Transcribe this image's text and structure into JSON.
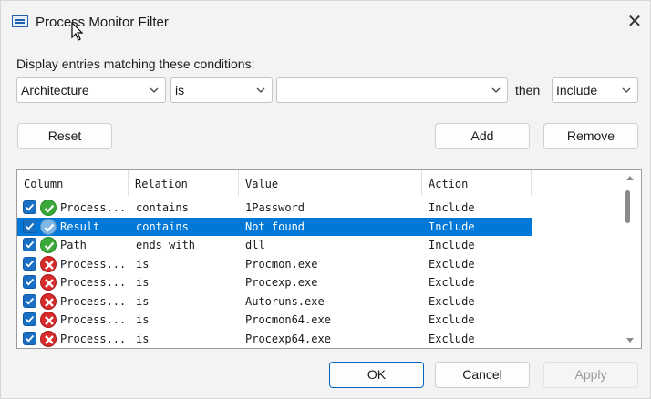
{
  "window": {
    "title": "Process Monitor Filter",
    "close_glyph": "✕"
  },
  "conditions": {
    "label": "Display entries matching these conditions:",
    "column_value": "Architecture",
    "relation_value": "is",
    "value_value": "",
    "then_label": "then",
    "action_value": "Include"
  },
  "buttons": {
    "reset": "Reset",
    "add": "Add",
    "remove": "Remove",
    "ok": "OK",
    "cancel": "Cancel",
    "apply": "Apply"
  },
  "table": {
    "headers": [
      "Column",
      "Relation",
      "Value",
      "Action"
    ],
    "rows": [
      {
        "column": "Process...",
        "relation": "contains",
        "value": "1Password",
        "action": "Include",
        "checked": true,
        "state": "include",
        "selected": false
      },
      {
        "column": "Result",
        "relation": "contains",
        "value": "Not found",
        "action": "Include",
        "checked": true,
        "state": "include",
        "selected": true
      },
      {
        "column": "Path",
        "relation": "ends with",
        "value": "dll",
        "action": "Include",
        "checked": true,
        "state": "include",
        "selected": false
      },
      {
        "column": "Process...",
        "relation": "is",
        "value": "Procmon.exe",
        "action": "Exclude",
        "checked": true,
        "state": "exclude",
        "selected": false
      },
      {
        "column": "Process...",
        "relation": "is",
        "value": "Procexp.exe",
        "action": "Exclude",
        "checked": true,
        "state": "exclude",
        "selected": false
      },
      {
        "column": "Process...",
        "relation": "is",
        "value": "Autoruns.exe",
        "action": "Exclude",
        "checked": true,
        "state": "exclude",
        "selected": false
      },
      {
        "column": "Process...",
        "relation": "is",
        "value": "Procmon64.exe",
        "action": "Exclude",
        "checked": true,
        "state": "exclude",
        "selected": false
      },
      {
        "column": "Process...",
        "relation": "is",
        "value": "Procexp64.exe",
        "action": "Exclude",
        "checked": true,
        "state": "exclude",
        "selected": false
      }
    ]
  },
  "icons": {
    "app": "process-monitor-icon",
    "include": "green-check-icon",
    "exclude": "red-x-icon",
    "checkbox": "checkbox-checked-icon"
  },
  "colors": {
    "accent": "#0078d7",
    "include_green": "#3aa83a",
    "exclude_red": "#d72b2b"
  }
}
